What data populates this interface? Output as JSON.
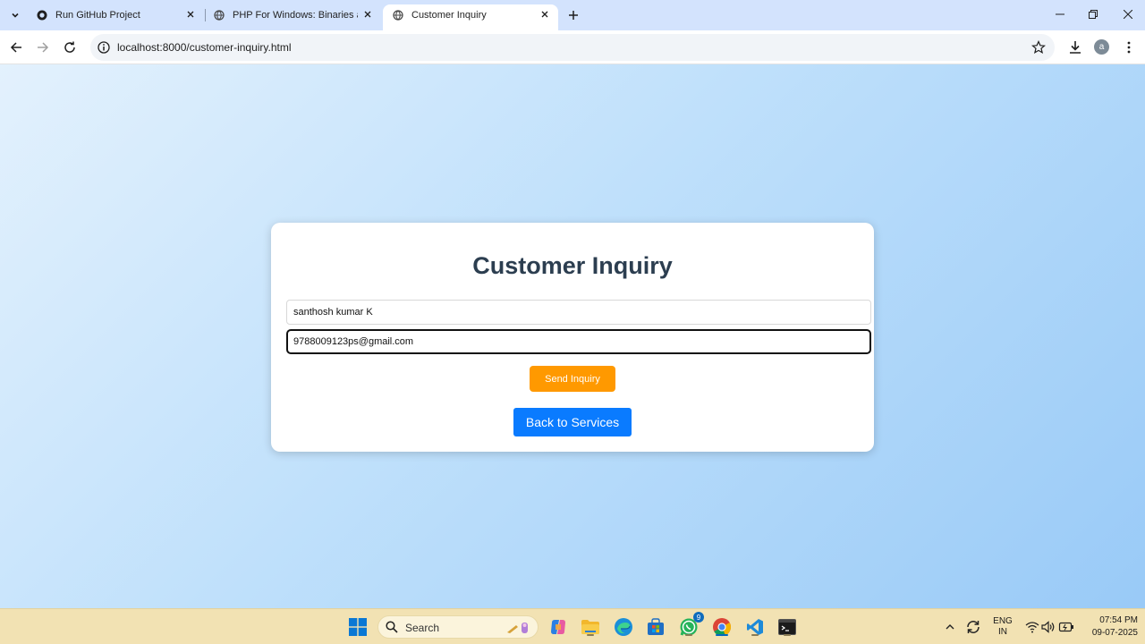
{
  "browser": {
    "tabs": [
      {
        "title": "Run GitHub Project",
        "icon": "github-icon"
      },
      {
        "title": "PHP For Windows: Binaries and",
        "icon": "globe-icon"
      },
      {
        "title": "Customer Inquiry",
        "icon": "globe-icon",
        "active": true
      }
    ],
    "url": "localhost:8000/customer-inquiry.html",
    "profile_initial": "a"
  },
  "page": {
    "title": "Customer Inquiry",
    "name_value": "santhosh kumar K",
    "email_value": "9788009123ps@gmail.com",
    "send_label": "Send Inquiry",
    "back_label": "Back to Services"
  },
  "colors": {
    "heading": "#2c3e50",
    "send_button": "#ff9900",
    "back_button": "#0a7bff",
    "background_from": "#e3f1fd",
    "background_to": "#99caf7"
  },
  "taskbar": {
    "search_label": "Search",
    "whatsapp_badge": "9",
    "lang_top": "ENG",
    "lang_bottom": "IN",
    "time": "07:54 PM",
    "date": "09-07-2025"
  }
}
